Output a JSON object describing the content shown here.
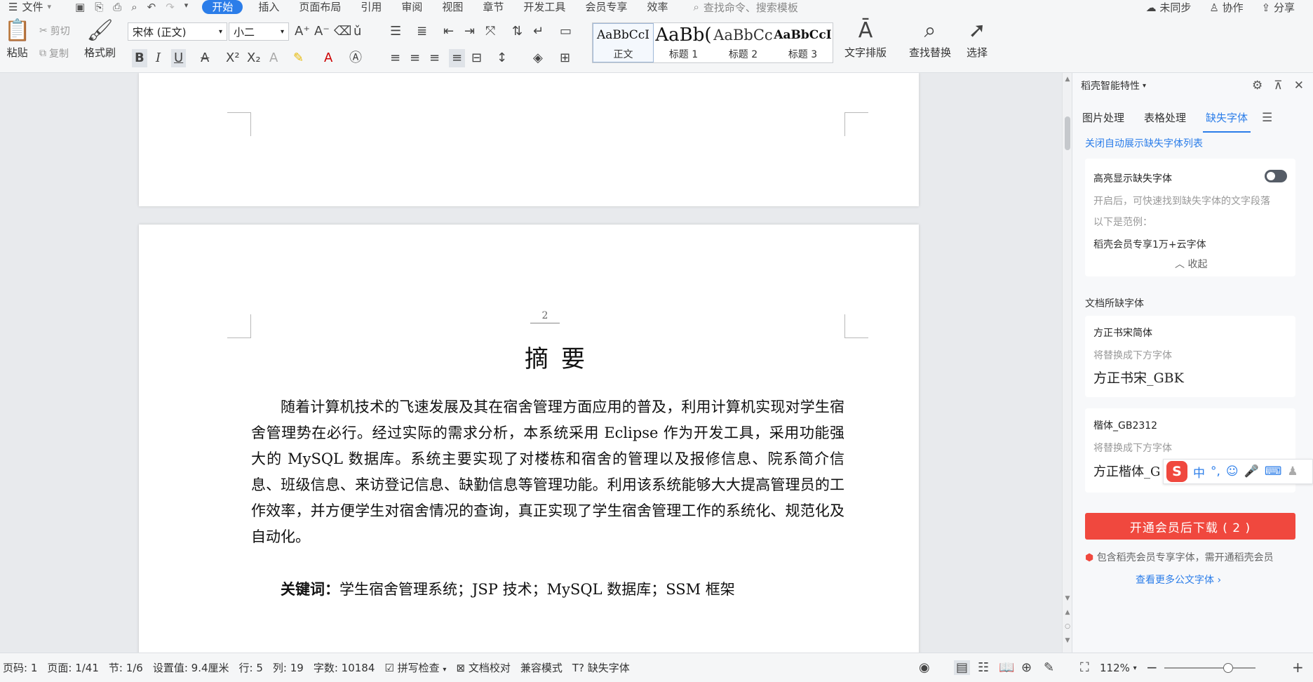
{
  "menubar": {
    "file": "文件",
    "tabs": [
      "开始",
      "插入",
      "页面布局",
      "引用",
      "审阅",
      "视图",
      "章节",
      "开发工具",
      "会员专享",
      "效率"
    ],
    "search_placeholder": "查找命令、搜索模板",
    "sync": "未同步",
    "collab": "协作",
    "share": "分享"
  },
  "ribbon": {
    "paste": "粘贴",
    "cut": "剪切",
    "copy": "复制",
    "format_painter": "格式刷",
    "font_name": "宋体 (正文)",
    "font_size": "小二",
    "styles": [
      {
        "preview": "AaBbCcI",
        "name": "正文"
      },
      {
        "preview": "AaBb(",
        "name": "标题 1"
      },
      {
        "preview": "AaBbCc",
        "name": "标题 2"
      },
      {
        "preview": "AaBbCcI",
        "name": "标题 3"
      }
    ],
    "text_layout": "文字排版",
    "find_replace": "查找替换",
    "select": "选择"
  },
  "document": {
    "page_number": "2",
    "heading": "摘要",
    "abstract": "随着计算机技术的飞速发展及其在宿舍管理方面应用的普及，利用计算机实现对学生宿舍管理势在必行。经过实际的需求分析，本系统采用 Eclipse 作为开发工具，采用功能强大的 MySQL 数据库。系统主要实现了对楼栋和宿舍的管理以及报修信息、院系简介信息、班级信息、来访登记信息、缺勤信息等管理功能。利用该系统能够大大提高管理员的工作效率，并方便学生对宿舍情况的查询，真正实现了学生宿舍管理工作的系统化、规范化及自动化。",
    "keywords_label": "关键词：",
    "keywords": "学生宿舍管理系统；JSP 技术；MySQL 数据库；SSM 框架"
  },
  "panel": {
    "title": "稻壳智能特性",
    "tabs": [
      "图片处理",
      "表格处理",
      "缺失字体"
    ],
    "close_auto_link": "关闭自动展示缺失字体列表",
    "highlight_title": "高亮显示缺失字体",
    "highlight_desc": "开启后，可快速找到缺失字体的文字段落",
    "example_label": "以下是范例：",
    "example_text": "稻壳会员专享1万+云字体",
    "collapse": "收起",
    "missing_title": "文档所缺字体",
    "fonts": [
      {
        "missing": "方正书宋简体",
        "replace_label": "将替换成下方字体",
        "replacement": "方正书宋_GBK"
      },
      {
        "missing": "楷体_GB2312",
        "replace_label": "将替换成下方字体",
        "replacement": "方正楷体_G"
      }
    ],
    "download_button": "开通会员后下载 ( 2 )",
    "member_note": "包含稻壳会员专享字体，需开通稻壳会员",
    "more_link": "查看更多公文字体",
    "ime": "中"
  },
  "status": {
    "page_code": "页码: 1",
    "page": "页面: 1/41",
    "section": "节: 1/6",
    "setting": "设置值: 9.4厘米",
    "row": "行: 5",
    "col": "列: 19",
    "words": "字数: 10184",
    "spell": "拼写检查",
    "proof": "文档校对",
    "compat": "兼容模式",
    "missing_font": "缺失字体",
    "zoom": "112%"
  },
  "colors": {
    "accent": "#2b7de9",
    "download": "#f0483e"
  }
}
